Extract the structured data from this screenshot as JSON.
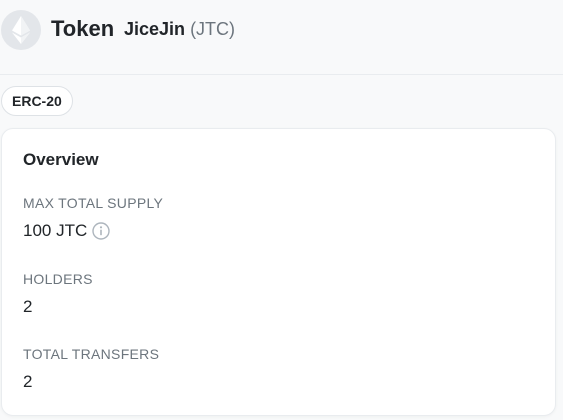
{
  "header": {
    "title": "Token",
    "token_name": "JiceJin",
    "token_symbol": "(JTC)",
    "logo_icon": "ethereum-icon"
  },
  "badge": {
    "label": "ERC-20"
  },
  "overview": {
    "title": "Overview",
    "max_supply_label": "MAX TOTAL SUPPLY",
    "max_supply_value": "100 JTC",
    "info_icon": "info-icon",
    "holders_label": "HOLDERS",
    "holders_value": "2",
    "transfers_label": "TOTAL TRANSFERS",
    "transfers_value": "2"
  },
  "colors": {
    "muted_text": "#6c757d",
    "primary_text": "#212529",
    "logo_bg": "#e3e6ea"
  }
}
